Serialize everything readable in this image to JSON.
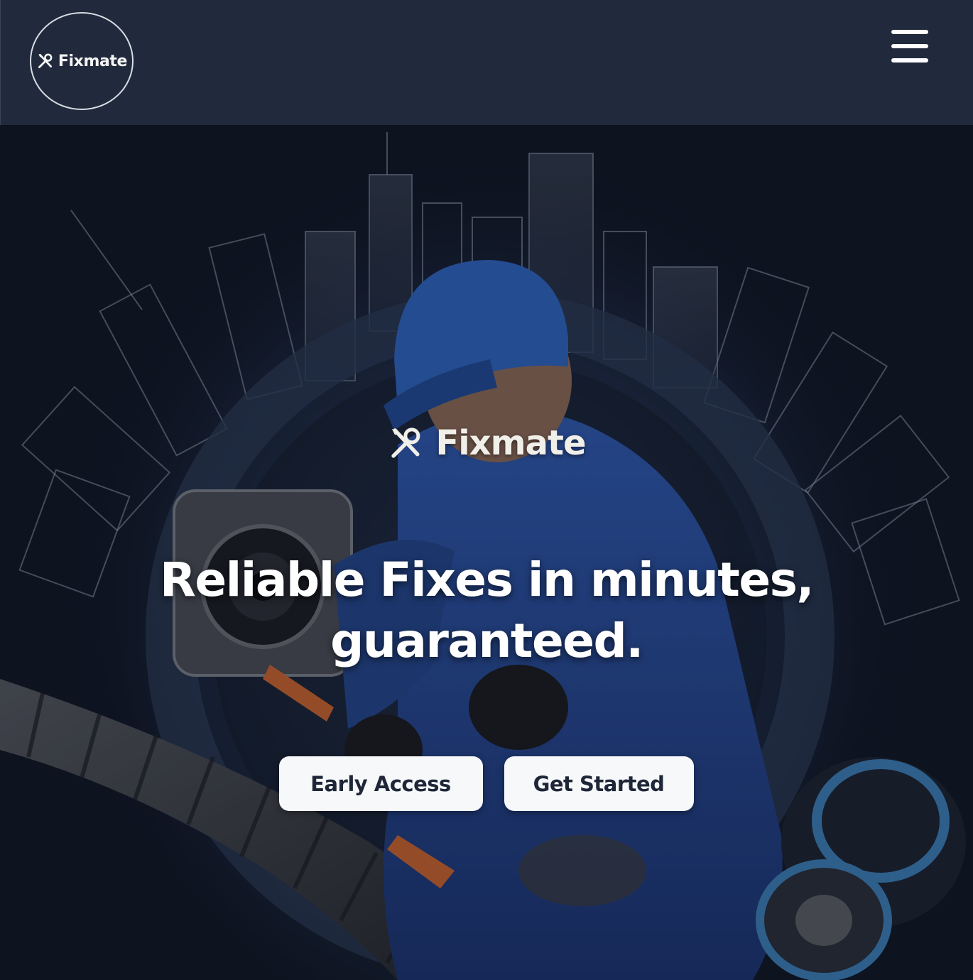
{
  "header": {
    "logo_text": "Fixmate",
    "menu_icon": "hamburger-menu-icon"
  },
  "hero": {
    "brand_text": "Fixmate",
    "brand_icon": "wrench-screwdriver-icon",
    "title": "Reliable Fixes in minutes, guaranteed.",
    "buttons": {
      "early_access": "Early Access",
      "get_started": "Get Started"
    }
  },
  "colors": {
    "header_bg": "#202a3c",
    "hero_bg": "#1a2436",
    "button_bg": "#f7f8fa",
    "button_text": "#1e2638",
    "worker_blue": "#2a4e9a"
  }
}
